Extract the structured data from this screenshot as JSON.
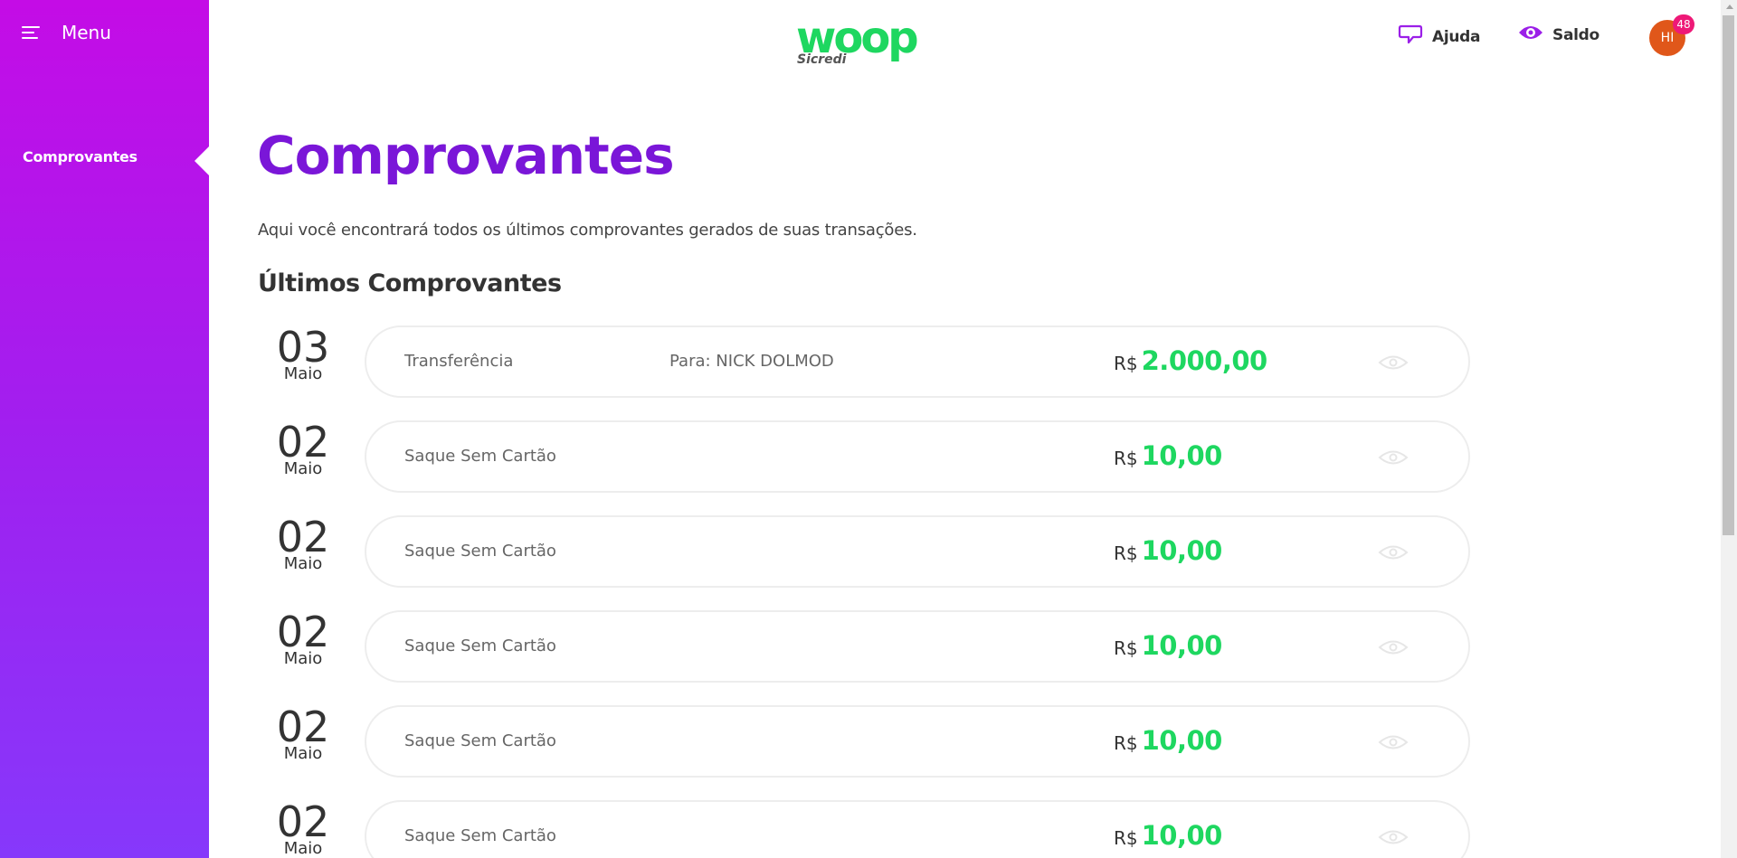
{
  "sidebar": {
    "menu_label": "Menu",
    "items": [
      {
        "label": "Comprovantes",
        "active": true
      }
    ]
  },
  "header": {
    "logo_text": "woop",
    "logo_sub": "Sicredi",
    "help_label": "Ajuda",
    "balance_label": "Saldo",
    "avatar_initials": "HI",
    "notification_count": "48"
  },
  "main": {
    "title": "Comprovantes",
    "description": "Aqui você encontrará todos os últimos comprovantes gerados de suas transações.",
    "section_title": "Últimos Comprovantes",
    "receipts": [
      {
        "day": "03",
        "month": "Maio",
        "type": "Transferência",
        "destination": "Para: NICK DOLMOD",
        "currency": "R$",
        "amount": "2.000,00"
      },
      {
        "day": "02",
        "month": "Maio",
        "type": "Saque Sem Cartão",
        "destination": "",
        "currency": "R$",
        "amount": "10,00"
      },
      {
        "day": "02",
        "month": "Maio",
        "type": "Saque Sem Cartão",
        "destination": "",
        "currency": "R$",
        "amount": "10,00"
      },
      {
        "day": "02",
        "month": "Maio",
        "type": "Saque Sem Cartão",
        "destination": "",
        "currency": "R$",
        "amount": "10,00"
      },
      {
        "day": "02",
        "month": "Maio",
        "type": "Saque Sem Cartão",
        "destination": "",
        "currency": "R$",
        "amount": "10,00"
      },
      {
        "day": "02",
        "month": "Maio",
        "type": "Saque Sem Cartão",
        "destination": "",
        "currency": "R$",
        "amount": "10,00"
      }
    ]
  },
  "colors": {
    "sidebar_top": "#c40ce6",
    "sidebar_bottom": "#8638fb",
    "title_purple": "#7a16d8",
    "amount_green": "#1ed760",
    "logo_green": "#1ed760",
    "icon_purple": "#9b1fe8",
    "avatar_orange": "#e0571a",
    "badge_pink": "#ee1977"
  },
  "icons": {
    "menu": "hamburger-icon",
    "help": "chat-bubble-icon",
    "balance": "eye-icon",
    "receipt_view": "eye-icon"
  }
}
